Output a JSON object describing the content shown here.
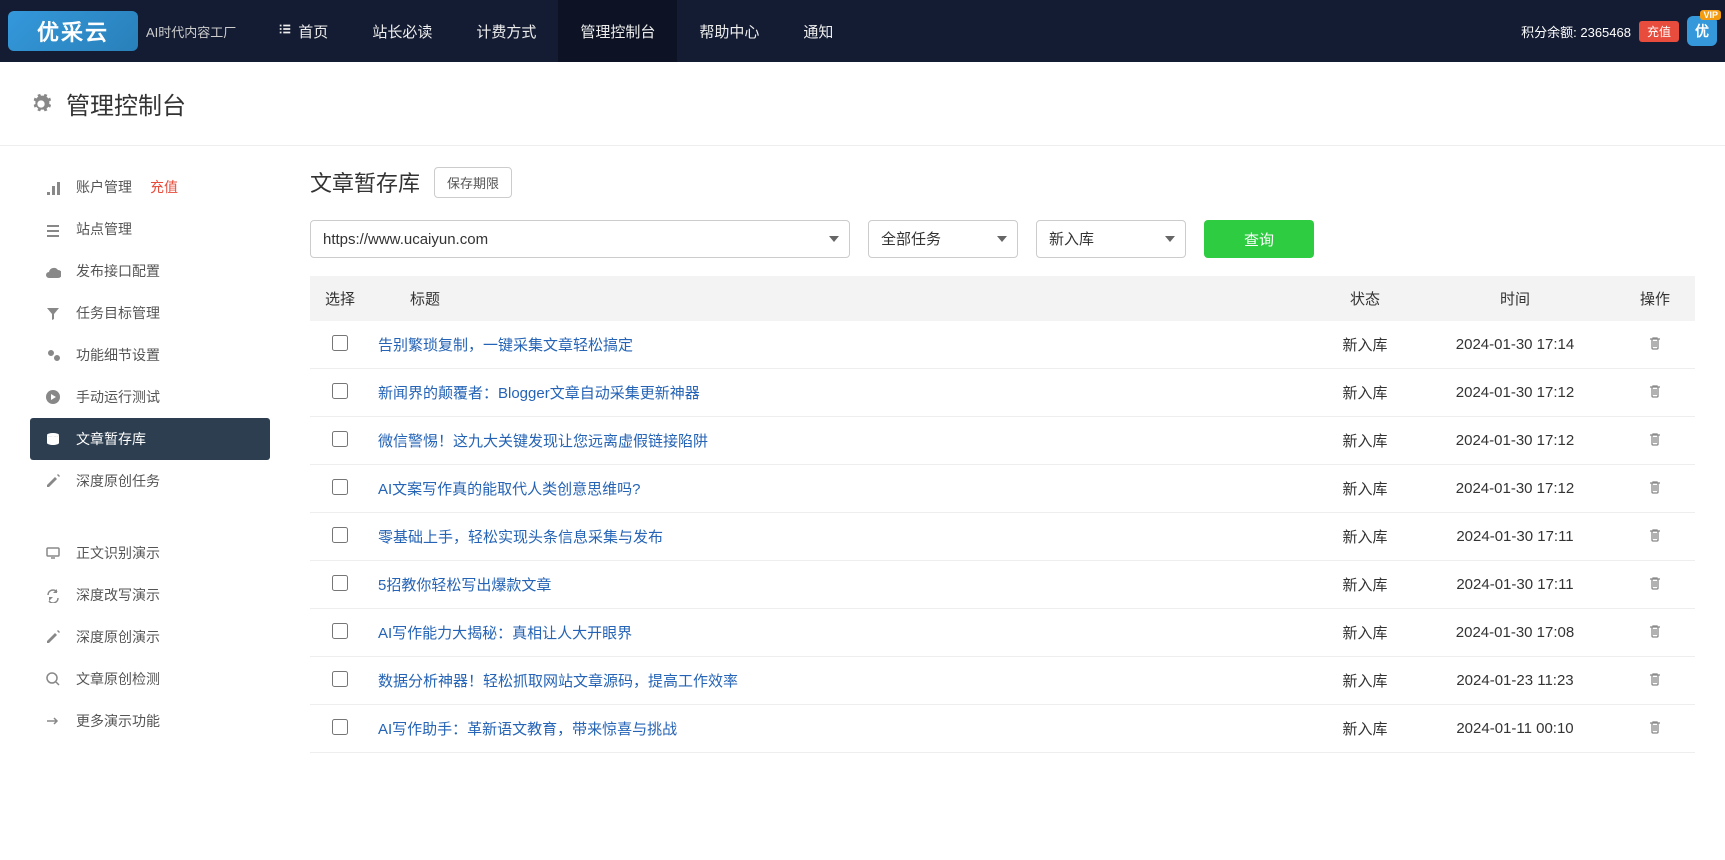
{
  "brand": {
    "logo": "优采云",
    "tagline": "AI时代内容工厂"
  },
  "nav": [
    {
      "label": "首页",
      "icon": "list"
    },
    {
      "label": "站长必读"
    },
    {
      "label": "计费方式"
    },
    {
      "label": "管理控制台",
      "active": true
    },
    {
      "label": "帮助中心"
    },
    {
      "label": "通知"
    }
  ],
  "topright": {
    "points_label": "积分余额: 2365468",
    "recharge": "充值",
    "vip": "优",
    "vip_badge": "VIP"
  },
  "page_title": "管理控制台",
  "sidebar": [
    {
      "icon": "bars",
      "label": "账户管理",
      "badge": "充值"
    },
    {
      "icon": "sliders",
      "label": "站点管理"
    },
    {
      "icon": "cloud",
      "label": "发布接口配置"
    },
    {
      "icon": "filter",
      "label": "任务目标管理"
    },
    {
      "icon": "cogs",
      "label": "功能细节设置"
    },
    {
      "icon": "play",
      "label": "手动运行测试"
    },
    {
      "icon": "db",
      "label": "文章暂存库",
      "active": true
    },
    {
      "icon": "edit",
      "label": "深度原创任务"
    },
    {
      "gap": true
    },
    {
      "icon": "monitor",
      "label": "正文识别演示"
    },
    {
      "icon": "refresh",
      "label": "深度改写演示"
    },
    {
      "icon": "edit",
      "label": "深度原创演示"
    },
    {
      "icon": "search",
      "label": "文章原创检测"
    },
    {
      "icon": "arrow",
      "label": "更多演示功能"
    }
  ],
  "content": {
    "title": "文章暂存库",
    "retain_btn": "保存期限",
    "filters": {
      "site": "https://www.ucaiyun.com",
      "task": "全部任务",
      "status": "新入库",
      "query": "查询"
    },
    "columns": {
      "select": "选择",
      "title": "标题",
      "status": "状态",
      "time": "时间",
      "action": "操作"
    },
    "rows": [
      {
        "title": "告别繁琐复制，一键采集文章轻松搞定",
        "status": "新入库",
        "time": "2024-01-30 17:14"
      },
      {
        "title": "新闻界的颠覆者：Blogger文章自动采集更新神器",
        "status": "新入库",
        "time": "2024-01-30 17:12"
      },
      {
        "title": "微信警惕！这九大关键发现让您远离虚假链接陷阱",
        "status": "新入库",
        "time": "2024-01-30 17:12"
      },
      {
        "title": "AI文案写作真的能取代人类创意思维吗?",
        "status": "新入库",
        "time": "2024-01-30 17:12"
      },
      {
        "title": "零基础上手，轻松实现头条信息采集与发布",
        "status": "新入库",
        "time": "2024-01-30 17:11"
      },
      {
        "title": "5招教你轻松写出爆款文章",
        "status": "新入库",
        "time": "2024-01-30 17:11"
      },
      {
        "title": "AI写作能力大揭秘：真相让人大开眼界",
        "status": "新入库",
        "time": "2024-01-30 17:08"
      },
      {
        "title": "数据分析神器！轻松抓取网站文章源码，提高工作效率",
        "status": "新入库",
        "time": "2024-01-23 11:23"
      },
      {
        "title": "AI写作助手：革新语文教育，带来惊喜与挑战",
        "status": "新入库",
        "time": "2024-01-11 00:10"
      }
    ]
  }
}
